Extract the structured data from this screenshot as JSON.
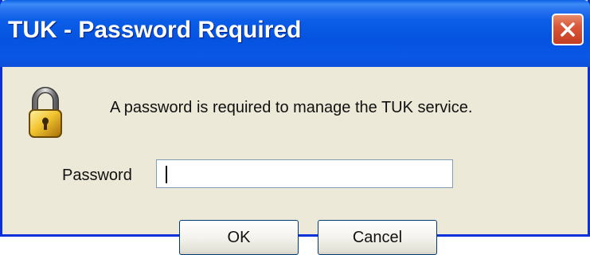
{
  "window": {
    "title": "TUK - Password Required",
    "close_icon": "close-icon"
  },
  "dialog": {
    "icon": "lock-icon",
    "message": "A password is required to manage the TUK service.",
    "password_label": "Password",
    "password_value": "",
    "ok_label": "OK",
    "cancel_label": "Cancel"
  },
  "colors": {
    "titlebar": "#0553e0",
    "client_background": "#ece9d8",
    "close_button": "#d9573a",
    "window_border": "#0831d9"
  }
}
